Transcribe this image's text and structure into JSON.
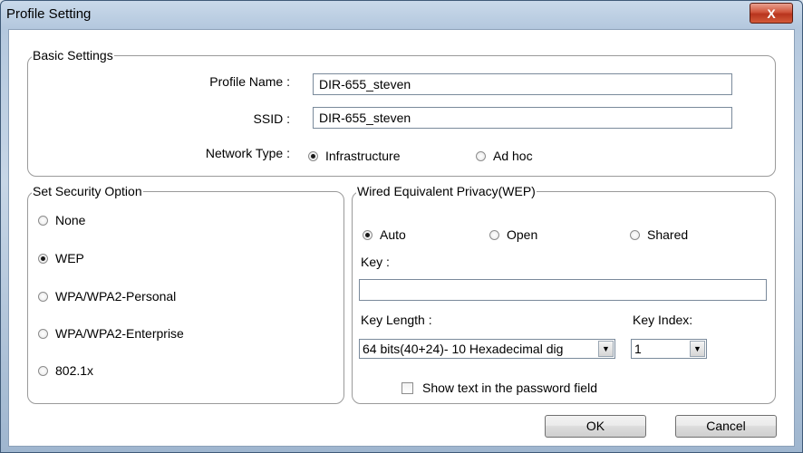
{
  "window": {
    "title": "Profile Setting",
    "close_glyph": "X"
  },
  "basic": {
    "legend": "Basic Settings",
    "profile_name_label": "Profile Name :",
    "profile_name_value": "DIR-655_steven",
    "ssid_label": "SSID :",
    "ssid_value": "DIR-655_steven",
    "network_type_label": "Network Type :",
    "network_types": [
      {
        "label": "Infrastructure",
        "selected": true
      },
      {
        "label": "Ad hoc",
        "selected": false
      }
    ]
  },
  "security": {
    "legend": "Set Security Option",
    "options": [
      {
        "label": "None",
        "selected": false
      },
      {
        "label": "WEP",
        "selected": true
      },
      {
        "label": "WPA/WPA2-Personal",
        "selected": false
      },
      {
        "label": "WPA/WPA2-Enterprise",
        "selected": false
      },
      {
        "label": "802.1x",
        "selected": false
      }
    ]
  },
  "wep": {
    "legend": "Wired Equivalent Privacy(WEP)",
    "auth_modes": [
      {
        "label": "Auto",
        "selected": true
      },
      {
        "label": "Open",
        "selected": false
      },
      {
        "label": "Shared",
        "selected": false
      }
    ],
    "key_label": "Key :",
    "key_value": "",
    "key_length_label": "Key Length :",
    "key_length_value": "64 bits(40+24)- 10 Hexadecimal dig",
    "key_index_label": "Key Index:",
    "key_index_value": "1",
    "show_text_label": "Show text in the password field",
    "show_text_checked": false
  },
  "buttons": {
    "ok": "OK",
    "cancel": "Cancel"
  },
  "icons": {
    "dropdown": "chevron-down-icon",
    "close": "close-icon"
  }
}
